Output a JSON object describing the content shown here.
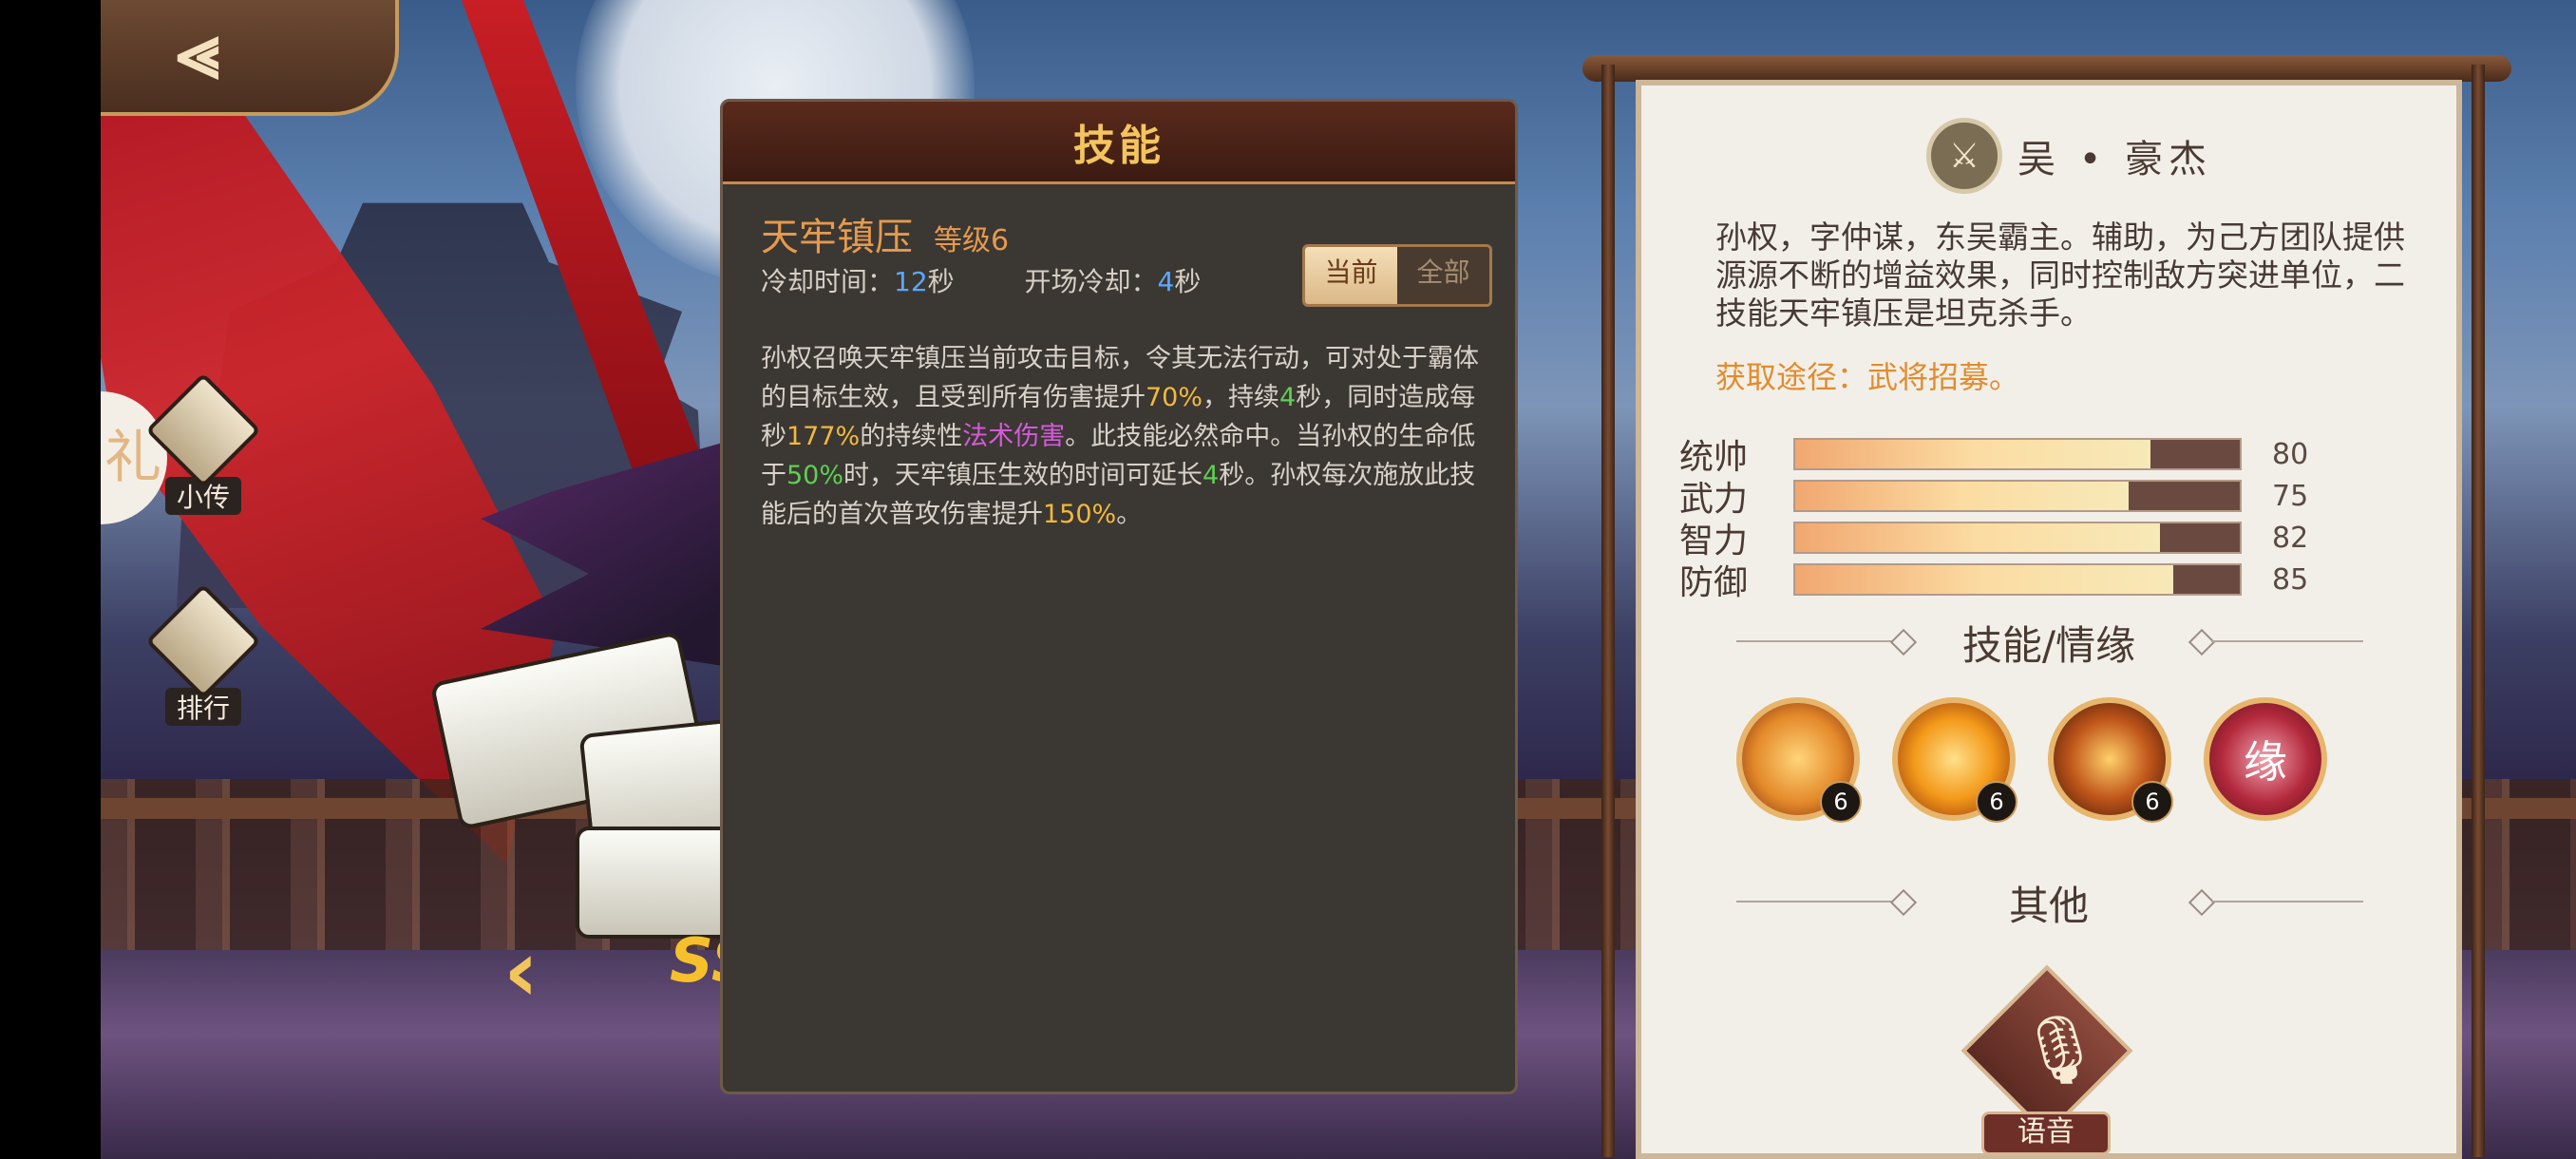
{
  "nav": {
    "back_icon": "⪡",
    "side_left_char": "礼"
  },
  "side_buttons": [
    {
      "label": "小传",
      "icon": "scroll-biography-icon"
    },
    {
      "label": "排行",
      "icon": "ranking-scroll-icon"
    }
  ],
  "stage": {
    "prev_arrow": "‹",
    "rank_text": "SS"
  },
  "skill_panel": {
    "header": "技能",
    "skill_name": "天牢镇压",
    "level_label": "等级6",
    "cooldown_label": "冷却时间：",
    "cooldown_value": "12",
    "cooldown_unit": "秒",
    "open_cd_label": "开场冷却：",
    "open_cd_value": "4",
    "open_cd_unit": "秒",
    "tabs": {
      "current": "当前",
      "all": "全部"
    },
    "desc": {
      "p1": "孙权召唤天牢镇压当前攻击目标，令其无法行动，可对处于霸体的目标生效，且受到所有伤害提升",
      "v1": "70%",
      "p2": "，持续",
      "v2": "4",
      "p3": "秒，同时造成每秒",
      "v3": "177%",
      "p4": "的持续性",
      "v4": "法术伤害",
      "p5": "。此技能必然命中。当孙权的生命低于",
      "v5": "50%",
      "p6": "时，天牢镇压生效的时间可延长",
      "v6": "4",
      "p7": "秒。孙权每次施放此技能后的首次普攻伤害提升",
      "v7": "150%",
      "p8": "。"
    }
  },
  "hero": {
    "faction_glyph": "⚔",
    "title": "吴 • 豪杰",
    "bio": "孙权，字仲谋，东吴霸主。辅助，为己方团队提供源源不断的增益效果，同时控制敌方突进单位，二技能天牢镇压是坦克杀手。",
    "acquire": "获取途径：武将招募。",
    "stats": [
      {
        "name": "统帅",
        "value": "80",
        "ratio": 0.8
      },
      {
        "name": "武力",
        "value": "75",
        "ratio": 0.75
      },
      {
        "name": "智力",
        "value": "82",
        "ratio": 0.82
      },
      {
        "name": "防御",
        "value": "85",
        "ratio": 0.85
      }
    ],
    "skills_title": "技能/情缘",
    "skills": [
      {
        "icon": "whirlwind-skill-icon",
        "level": "6",
        "color": "#e48a2a"
      },
      {
        "icon": "flame-warrior-skill-icon",
        "level": "6",
        "color": "#f39a1a"
      },
      {
        "icon": "sword-strike-skill-icon",
        "level": "6",
        "color": "#c0561a"
      },
      {
        "icon": "fate-yuan-icon",
        "level": "",
        "color": "#b3293c",
        "glyph": "缘"
      }
    ],
    "other_title": "其他",
    "voice_label": "语音"
  },
  "colors": {
    "accent_gold": "#f4c55e",
    "skill_orange": "#e59a4d",
    "highlight_yellow": "#f2b93e",
    "highlight_green": "#5ed052",
    "highlight_purple": "#d65adb",
    "cd_blue": "#5aa8ff"
  }
}
